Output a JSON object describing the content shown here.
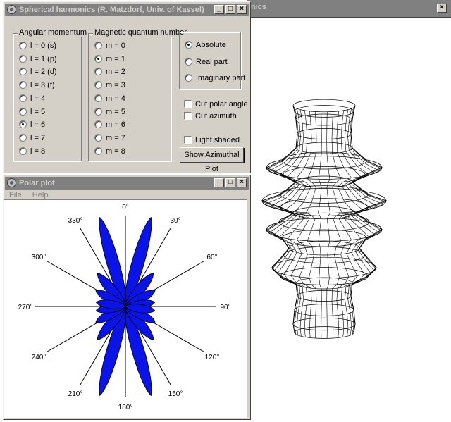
{
  "main_window": {
    "title": "Spherical harmonics (R. Matzdorf, Univ. of Kassel)",
    "bg_title_fragment": "nics",
    "angular_group": {
      "label": "Angular momentum",
      "items": [
        {
          "label": "l = 0  (s)",
          "selected": false
        },
        {
          "label": "l = 1  (p)",
          "selected": false
        },
        {
          "label": "l = 2  (d)",
          "selected": false
        },
        {
          "label": "l = 3  (f)",
          "selected": false
        },
        {
          "label": "l = 4",
          "selected": false
        },
        {
          "label": "l = 5",
          "selected": false
        },
        {
          "label": "l = 6",
          "selected": true
        },
        {
          "label": "l = 7",
          "selected": false
        },
        {
          "label": "l = 8",
          "selected": false
        }
      ]
    },
    "magnetic_group": {
      "label": "Magnetic quantum number",
      "items": [
        {
          "label": "m = 0",
          "selected": false
        },
        {
          "label": "m = 1",
          "selected": true
        },
        {
          "label": "m = 2",
          "selected": false
        },
        {
          "label": "m = 3",
          "selected": false
        },
        {
          "label": "m = 4",
          "selected": false
        },
        {
          "label": "m = 5",
          "selected": false
        },
        {
          "label": "m = 6",
          "selected": false
        },
        {
          "label": "m = 7",
          "selected": false
        },
        {
          "label": "m = 8",
          "selected": false
        }
      ]
    },
    "part_group": {
      "items": [
        {
          "label": "Absolute",
          "selected": true
        },
        {
          "label": "Real part",
          "selected": false
        },
        {
          "label": "Imaginary part",
          "selected": false
        }
      ]
    },
    "checkboxes": {
      "cut_polar": "Cut polar angle",
      "cut_azimuth": "Cut azimuth",
      "light_shaded": "Light shaded"
    },
    "azimuthal_button": "Show Azimuthal Plot"
  },
  "polar_window": {
    "title": "Polar plot",
    "menu": {
      "file": "File",
      "help": "Help"
    }
  },
  "window_buttons": {
    "minimize": "_",
    "maximize": "□",
    "close": "×"
  },
  "chart_data": {
    "type": "polar",
    "angle_labels": [
      "0°",
      "30°",
      "60°",
      "90°",
      "120°",
      "150°",
      "180°",
      "210°",
      "240°",
      "270°",
      "300°",
      "330°"
    ],
    "angles_deg": [
      0,
      30,
      60,
      90,
      120,
      150,
      180,
      210,
      240,
      270,
      300,
      330
    ],
    "lobes": [
      {
        "angle_deg": 16,
        "length": 0.94,
        "width": 0.15
      },
      {
        "angle_deg": 40,
        "length": 0.44,
        "width": 0.12
      },
      {
        "angle_deg": 62,
        "length": 0.34,
        "width": 0.11
      },
      {
        "angle_deg": 82,
        "length": 0.3,
        "width": 0.1
      }
    ],
    "symmetry": "mirror about both axes",
    "fill_color": "#0a14e6"
  },
  "colors": {
    "window": "#d4d0c8",
    "inactive_title": "#808080",
    "lobe": "#0a14e6"
  }
}
